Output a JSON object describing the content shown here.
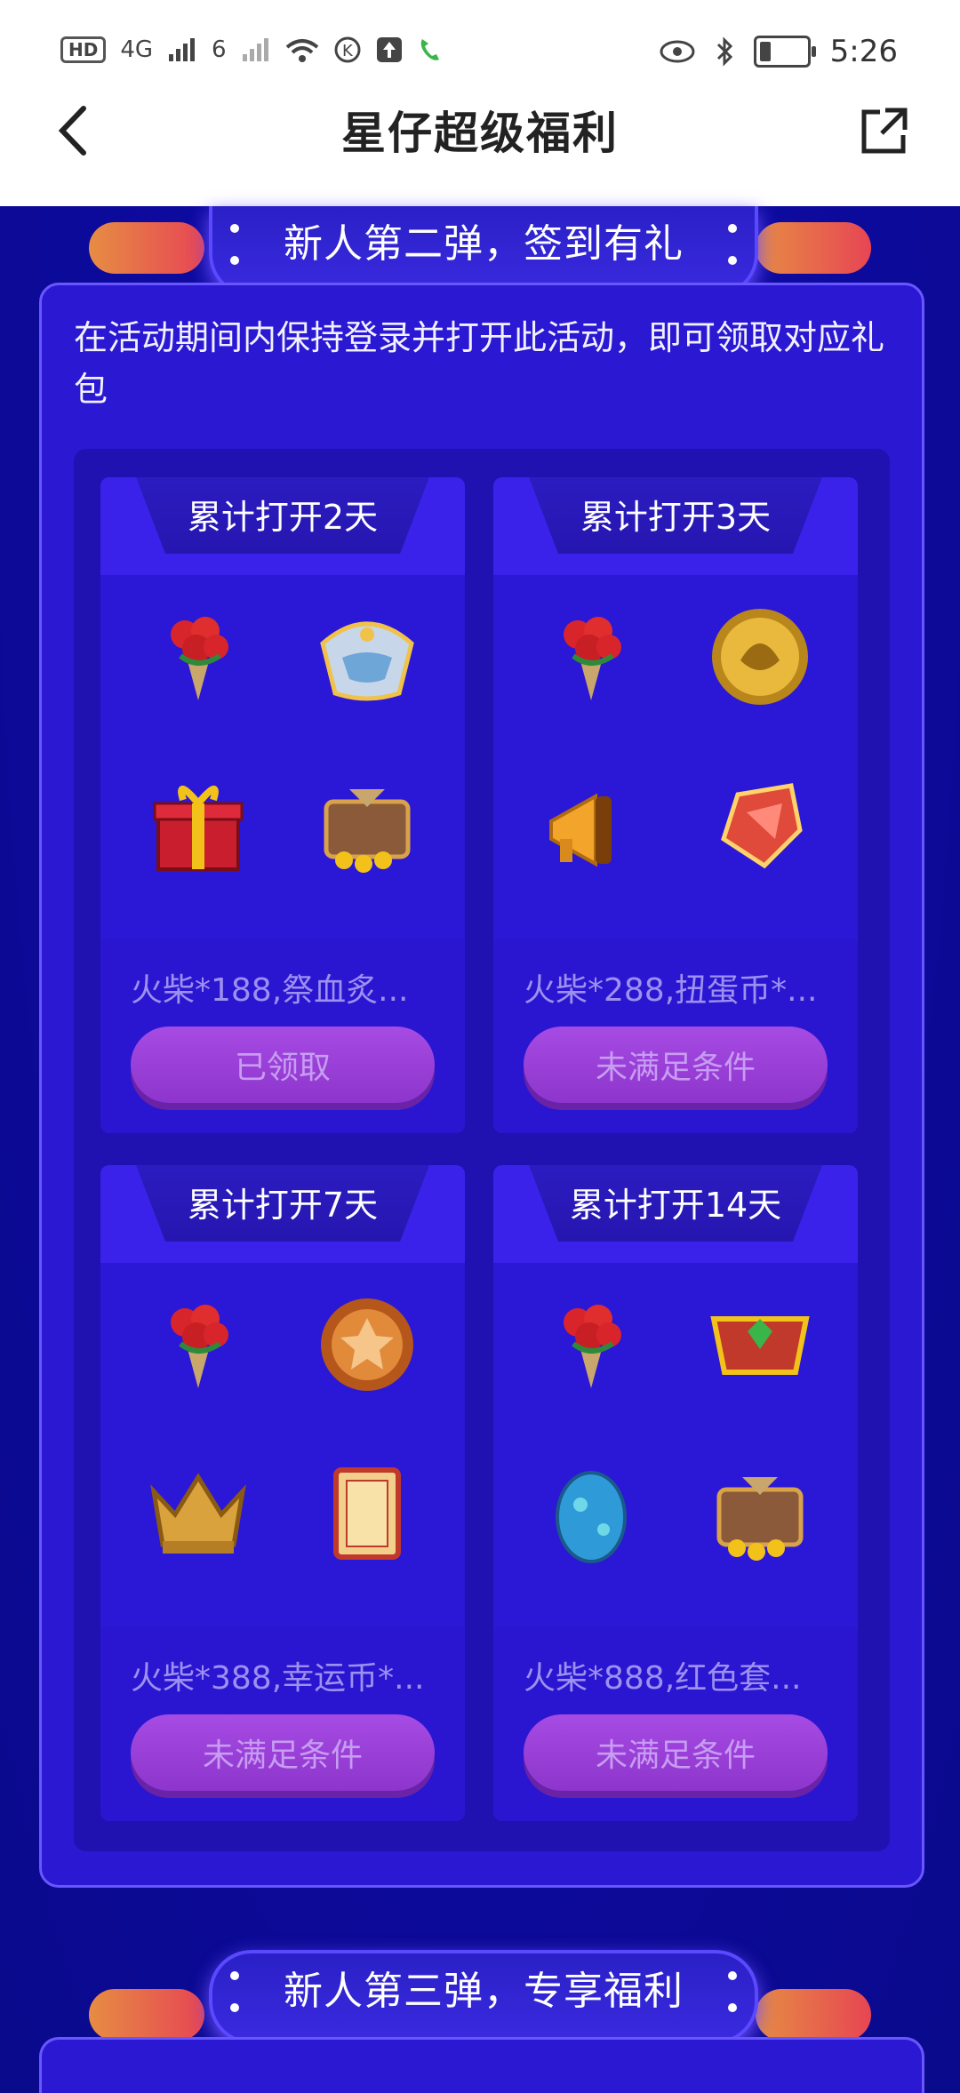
{
  "status_bar": {
    "left_badges": [
      "HD",
      "4G",
      "6"
    ],
    "time": "5:26"
  },
  "navbar": {
    "title": "星仔超级福利"
  },
  "section2": {
    "banner_title": "新人第二弹，签到有礼",
    "description": "在活动期间内保持登录并打开此活动，即可领取对应礼包",
    "cards": [
      {
        "title": "累计打开2天",
        "desc": "火柴*188,祭血炙...",
        "button": "已领取"
      },
      {
        "title": "累计打开3天",
        "desc": "火柴*288,扭蛋币*...",
        "button": "未满足条件"
      },
      {
        "title": "累计打开7天",
        "desc": "火柴*388,幸运币*...",
        "button": "未满足条件"
      },
      {
        "title": "累计打开14天",
        "desc": "火柴*888,红色套...",
        "button": "未满足条件"
      }
    ]
  },
  "section3": {
    "banner_title": "新人第三弹，专享福利"
  },
  "colors": {
    "background": "#0a0a8c",
    "panel": "#2a18d2",
    "button": "#a64be3",
    "button_text": "#c79cf2"
  },
  "icons": {
    "card1": [
      "flower-bouquet-icon",
      "silver-helmet-icon",
      "gift-box-icon",
      "treasure-chest-icon"
    ],
    "card2": [
      "flower-bouquet-icon",
      "dragon-coin-icon",
      "megaphone-icon",
      "red-crystal-icon"
    ],
    "card3": [
      "flower-bouquet-icon",
      "lucky-coin-icon",
      "golden-crown-icon",
      "treasure-ticket-icon"
    ],
    "card4": [
      "flower-bouquet-icon",
      "red-armor-icon",
      "blue-egg-icon",
      "treasure-chest-icon"
    ]
  }
}
